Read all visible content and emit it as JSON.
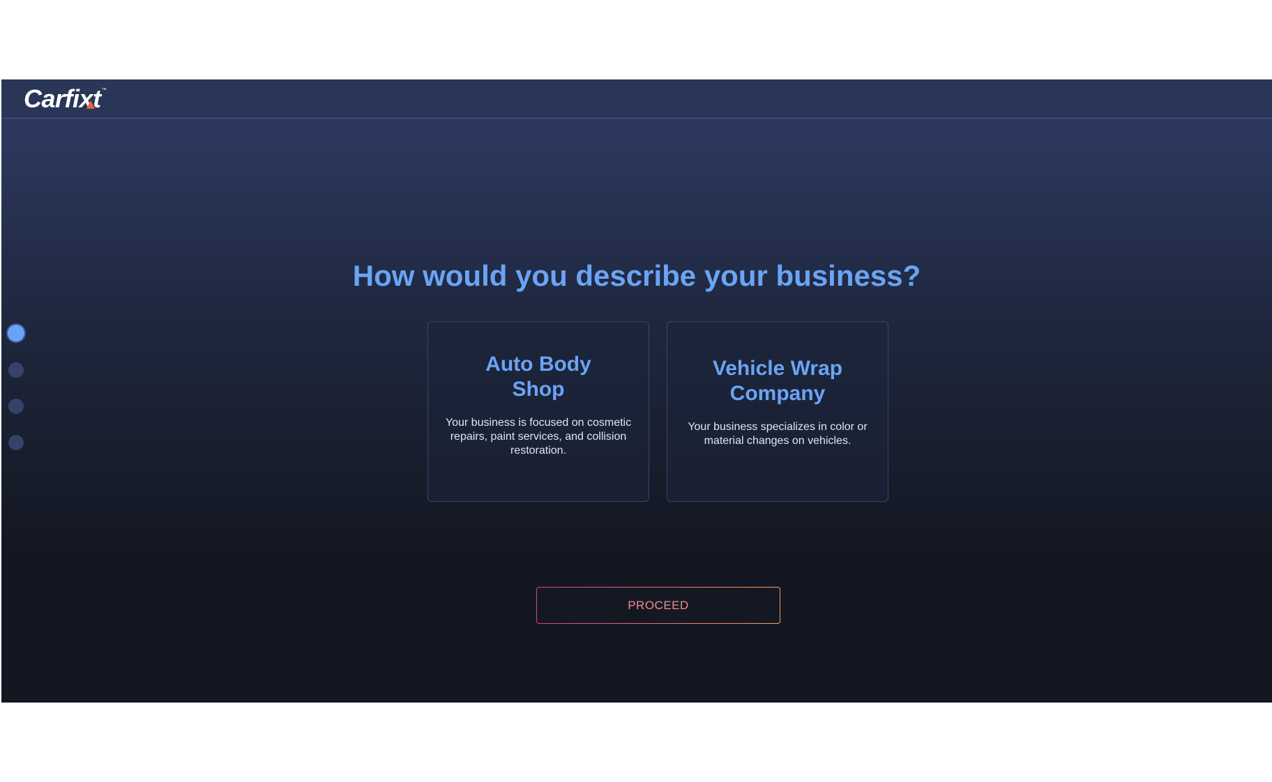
{
  "header": {
    "logo_text_pre": "Carfi",
    "logo_text_x": "x",
    "logo_text_post": "t",
    "logo_tm": "™"
  },
  "steps": {
    "total": 4,
    "current": 1
  },
  "main": {
    "headline": "How would you describe your business?",
    "options": [
      {
        "title": "Auto Body Shop",
        "description": "Your business is focused on cosmetic repairs, paint services, and collision restoration."
      },
      {
        "title": "Vehicle Wrap Company",
        "description": "Your business specializes in color or material changes on vehicles."
      }
    ],
    "proceed_label": "PROCEED"
  },
  "colors": {
    "accent_blue": "#6aa4f4",
    "logo_accent": "#e8643a",
    "button_gradient_start": "#e03e8c",
    "button_gradient_end": "#f5a35a",
    "button_text": "#f08a8a"
  }
}
